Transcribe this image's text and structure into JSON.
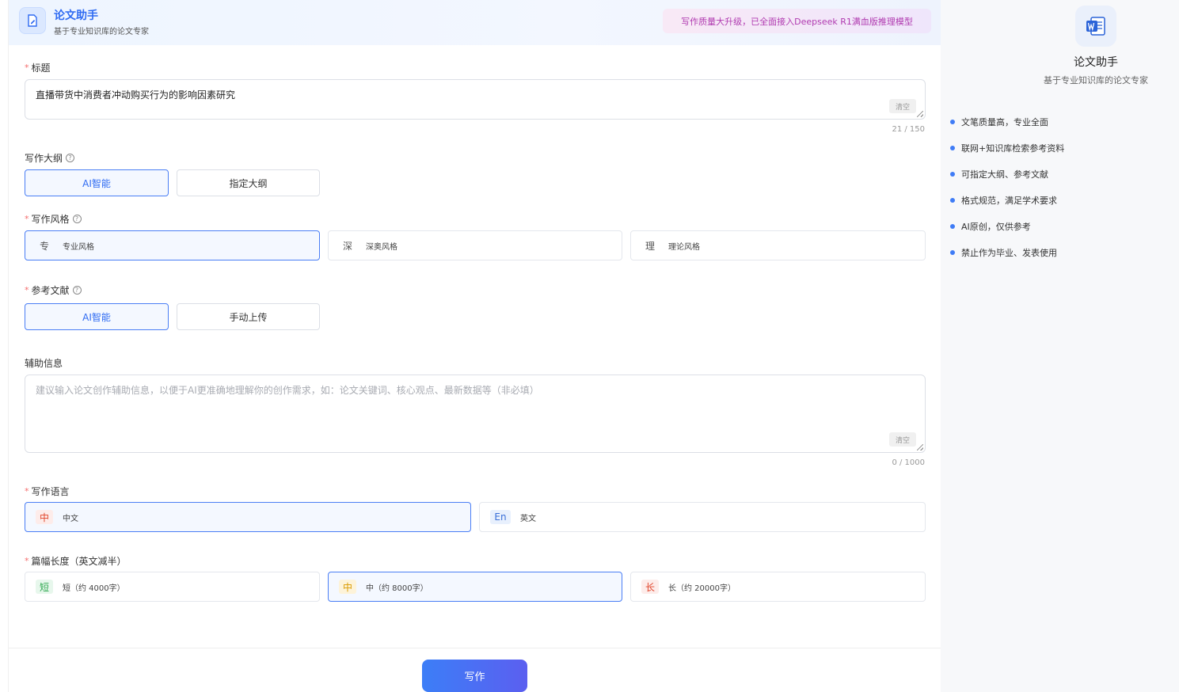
{
  "header": {
    "title": "论文助手",
    "subtitle": "基于专业知识库的论文专家",
    "banner": "写作质量大升级，已全面接入Deepseek R1满血版推理模型"
  },
  "title_field": {
    "label": "标题",
    "value": "直播带货中消费者冲动购买行为的影响因素研究",
    "clear": "清空",
    "counter": "21 / 150"
  },
  "outline": {
    "label": "写作大纲",
    "options": [
      "AI智能",
      "指定大纲"
    ],
    "selected": "AI智能"
  },
  "style": {
    "label": "写作风格",
    "options": [
      {
        "badge": "专",
        "label": "专业风格"
      },
      {
        "badge": "深",
        "label": "深奥风格"
      },
      {
        "badge": "理",
        "label": "理论风格"
      }
    ],
    "selected": "专业风格"
  },
  "references": {
    "label": "参考文献",
    "options": [
      "AI智能",
      "手动上传"
    ],
    "selected": "AI智能"
  },
  "aux": {
    "label": "辅助信息",
    "placeholder": "建议输入论文创作辅助信息，以便于AI更准确地理解你的创作需求，如：论文关键词、核心观点、最新数据等（非必填）",
    "clear": "清空",
    "counter": "0 / 1000"
  },
  "language": {
    "label": "写作语言",
    "options": [
      {
        "badge": "中",
        "label": "中文"
      },
      {
        "badge": "En",
        "label": "英文"
      }
    ],
    "selected": "中文"
  },
  "length": {
    "label": "篇幅长度（英文减半）",
    "options": [
      {
        "badge": "短",
        "label": "短（约 4000字）"
      },
      {
        "badge": "中",
        "label": "中（约 8000字）"
      },
      {
        "badge": "长",
        "label": "长（约 20000字）"
      }
    ],
    "selected": "中（约 8000字）"
  },
  "submit": {
    "label": "写作"
  },
  "sidebar": {
    "title": "论文助手",
    "subtitle": "基于专业知识库的论文专家",
    "features": [
      "文笔质量高，专业全面",
      "联网+知识库检索参考资料",
      "可指定大纲、参考文献",
      "格式规范，满足学术要求",
      "AI原创，仅供参考",
      "禁止作为毕业、发表使用"
    ]
  },
  "colors": {
    "accent": "#2f6bf2",
    "required": "#f56c6c",
    "banner_text": "#b03ab0"
  }
}
